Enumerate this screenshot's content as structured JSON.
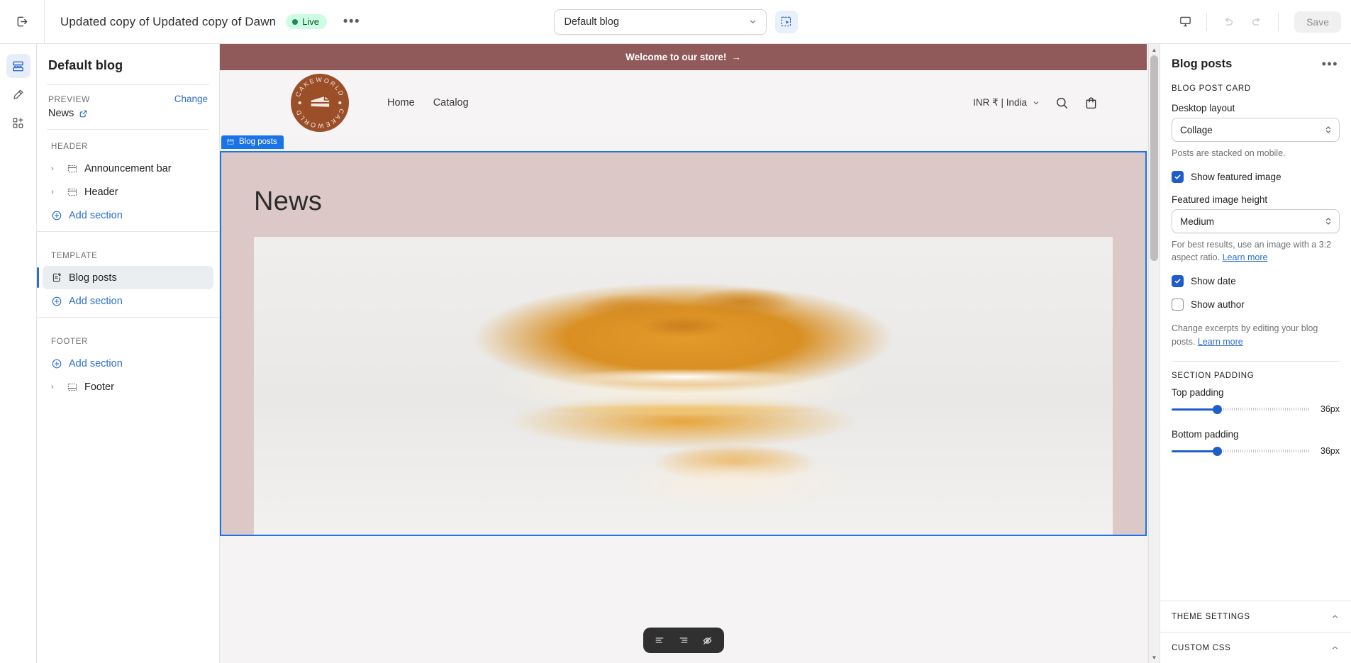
{
  "topbar": {
    "exit_icon": "exit-icon",
    "theme_name": "Updated copy of Updated copy of Dawn",
    "live_badge": "Live",
    "more_label": "•••",
    "blog_selector_value": "Default blog",
    "inspector_icon": "inspector-select-icon",
    "device_icon": "desktop-icon",
    "undo_icon": "undo-icon",
    "redo_icon": "redo-icon",
    "save_label": "Save"
  },
  "rail": {
    "items": [
      {
        "name": "sections-icon",
        "active": true
      },
      {
        "name": "theme-style-icon",
        "active": false
      },
      {
        "name": "apps-icon",
        "active": false
      }
    ]
  },
  "sidebar": {
    "title": "Default blog",
    "preview_label": "PREVIEW",
    "change_label": "Change",
    "preview_value": "News",
    "external_icon": "external-link-icon",
    "groups": [
      {
        "title": "HEADER",
        "items": [
          {
            "label": "Announcement bar",
            "icon": "section-icon",
            "expandable": true,
            "selected": false
          },
          {
            "label": "Header",
            "icon": "section-icon",
            "expandable": true,
            "selected": false
          }
        ],
        "add_label": "Add section"
      },
      {
        "title": "TEMPLATE",
        "items": [
          {
            "label": "Blog posts",
            "icon": "blog-posts-icon",
            "expandable": false,
            "selected": true
          }
        ],
        "add_label": "Add section"
      },
      {
        "title": "FOOTER",
        "items": [
          {
            "label": "Footer",
            "icon": "section-icon",
            "expandable": true,
            "selected": false
          }
        ],
        "add_label": "Add section"
      }
    ]
  },
  "preview": {
    "announcement": "Welcome to our store!",
    "announcement_arrow": "→",
    "logo_text": "CAKEWORLD",
    "nav": [
      {
        "label": "Home"
      },
      {
        "label": "Catalog"
      }
    ],
    "currency": "INR ₹ | India",
    "search_icon": "search-icon",
    "cart_icon": "cart-icon",
    "section_tag": "Blog posts",
    "section_tag_icon": "section-icon",
    "page_title": "News",
    "toolbar": [
      {
        "name": "align-left-icon"
      },
      {
        "name": "align-right-icon"
      },
      {
        "name": "eye-off-icon"
      }
    ],
    "colors": {
      "announcement_bg": "#90595a",
      "section_bg": "#dcc9c7",
      "highlight": "#1a73e8",
      "logo_bg": "#9a4f28"
    }
  },
  "right_panel": {
    "title": "Blog posts",
    "more_label": "•••",
    "card_group_title": "BLOG POST CARD",
    "desktop_layout": {
      "label": "Desktop layout",
      "value": "Collage",
      "help": "Posts are stacked on mobile."
    },
    "show_featured_image": {
      "label": "Show featured image",
      "checked": true
    },
    "featured_image_height": {
      "label": "Featured image height",
      "value": "Medium",
      "help_prefix": "For best results, use an image with a 3:2 aspect ratio. ",
      "help_link": "Learn more"
    },
    "show_date": {
      "label": "Show date",
      "checked": true
    },
    "show_author": {
      "label": "Show author",
      "checked": false
    },
    "excerpt_help_prefix": "Change excerpts by editing your blog posts. ",
    "excerpt_help_link": "Learn more",
    "section_padding_title": "SECTION PADDING",
    "top_padding": {
      "label": "Top padding",
      "value": "36px",
      "percent": 33
    },
    "bottom_padding": {
      "label": "Bottom padding",
      "value": "36px",
      "percent": 33
    },
    "accordions": [
      {
        "label": "THEME SETTINGS",
        "icon": "chevron-up-icon"
      },
      {
        "label": "CUSTOM CSS",
        "icon": "chevron-up-icon"
      }
    ]
  }
}
